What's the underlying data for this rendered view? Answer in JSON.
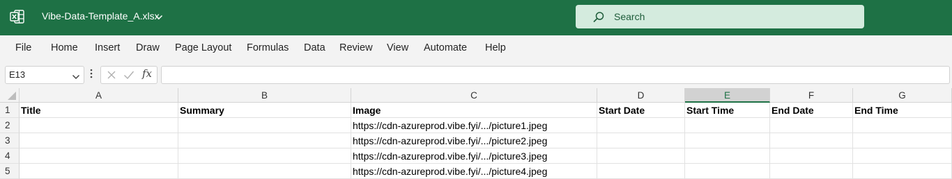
{
  "titlebar": {
    "filename": "Vibe-Data-Template_A.xlsx",
    "app_icon": "excel-icon",
    "search_placeholder": "Search",
    "colors": {
      "background": "#1e7145",
      "search_bg": "#d4ebde"
    }
  },
  "ribbon": {
    "tabs": [
      "File",
      "Home",
      "Insert",
      "Draw",
      "Page Layout",
      "Formulas",
      "Data",
      "Review",
      "View",
      "Automate",
      "Help"
    ]
  },
  "formula_bar": {
    "name_box": "E13",
    "fx_label": "fx",
    "formula": ""
  },
  "sheet": {
    "columns": [
      "A",
      "B",
      "C",
      "D",
      "E",
      "F",
      "G"
    ],
    "selected_column": "E",
    "row_numbers": [
      "1",
      "2",
      "3",
      "4",
      "5"
    ],
    "rows": [
      [
        "Title",
        "Summary",
        "Image",
        "Start Date",
        "Start Time",
        "End Date",
        "End Time"
      ],
      [
        "",
        "",
        "https://cdn-azureprod.vibe.fyi/.../picture1.jpeg",
        "",
        "",
        "",
        ""
      ],
      [
        "",
        "",
        "https://cdn-azureprod.vibe.fyi/.../picture2.jpeg",
        "",
        "",
        "",
        ""
      ],
      [
        "",
        "",
        "https://cdn-azureprod.vibe.fyi/.../picture3.jpeg",
        "",
        "",
        "",
        ""
      ],
      [
        "",
        "",
        "https://cdn-azureprod.vibe.fyi/.../picture4.jpeg",
        "",
        "",
        "",
        ""
      ]
    ],
    "accent_color": "#1e7145"
  }
}
